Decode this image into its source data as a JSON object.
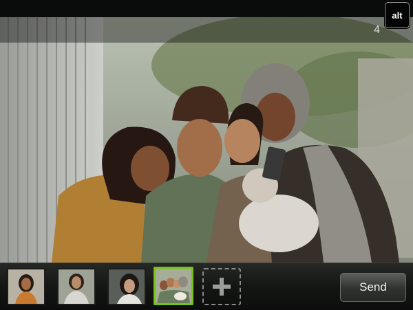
{
  "status_bar": {
    "alt_key_label": "alt"
  },
  "photo_viewer": {
    "counter_text": "4"
  },
  "attachment_tray": {
    "thumbnails": [
      {
        "name": "photo-1",
        "selected": false
      },
      {
        "name": "photo-2",
        "selected": false
      },
      {
        "name": "photo-3",
        "selected": false
      },
      {
        "name": "photo-4",
        "selected": true
      }
    ],
    "add_icon": "plus-icon",
    "send_label": "Send"
  },
  "colors": {
    "selected_border": "#79c11b",
    "tray_background": "#141614",
    "button_text": "#f2f2f2"
  }
}
